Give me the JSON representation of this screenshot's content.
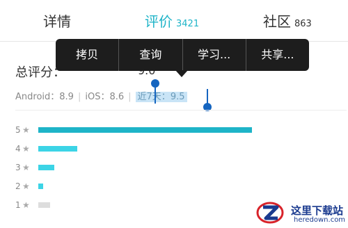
{
  "tabs": {
    "details": {
      "label": "详情"
    },
    "reviews": {
      "label": "评价",
      "count": "3421"
    },
    "community": {
      "label": "社区",
      "count": "863"
    }
  },
  "summary": {
    "total_label": "总评分：",
    "total_score": "9.0",
    "android_label": "Android：",
    "android_score": "8.9",
    "ios_label": "iOS：",
    "ios_score": "8.6",
    "recent_label": "近7天：",
    "recent_score": "9.5",
    "separator": "|"
  },
  "context_menu": [
    "拷贝",
    "查询",
    "学习...",
    "共享..."
  ],
  "distribution": [
    {
      "stars": "5",
      "fraction": 0.93,
      "color": "#1eb4c8"
    },
    {
      "stars": "4",
      "fraction": 0.17,
      "color": "#3cd4e6"
    },
    {
      "stars": "3",
      "fraction": 0.07,
      "color": "#3cd4e6"
    },
    {
      "stars": "2",
      "fraction": 0.02,
      "color": "#3cd4e6"
    },
    {
      "stars": "1",
      "fraction": 0.05,
      "color": "#dddddd"
    }
  ],
  "star_icon": "★",
  "watermark": {
    "title": "这里下载站",
    "url": "heredown.com"
  },
  "colors": {
    "accent": "#1eb4c8",
    "menu_bg": "#1d1d1d",
    "selection": "#c9e4f6",
    "handle": "#1565c0"
  }
}
